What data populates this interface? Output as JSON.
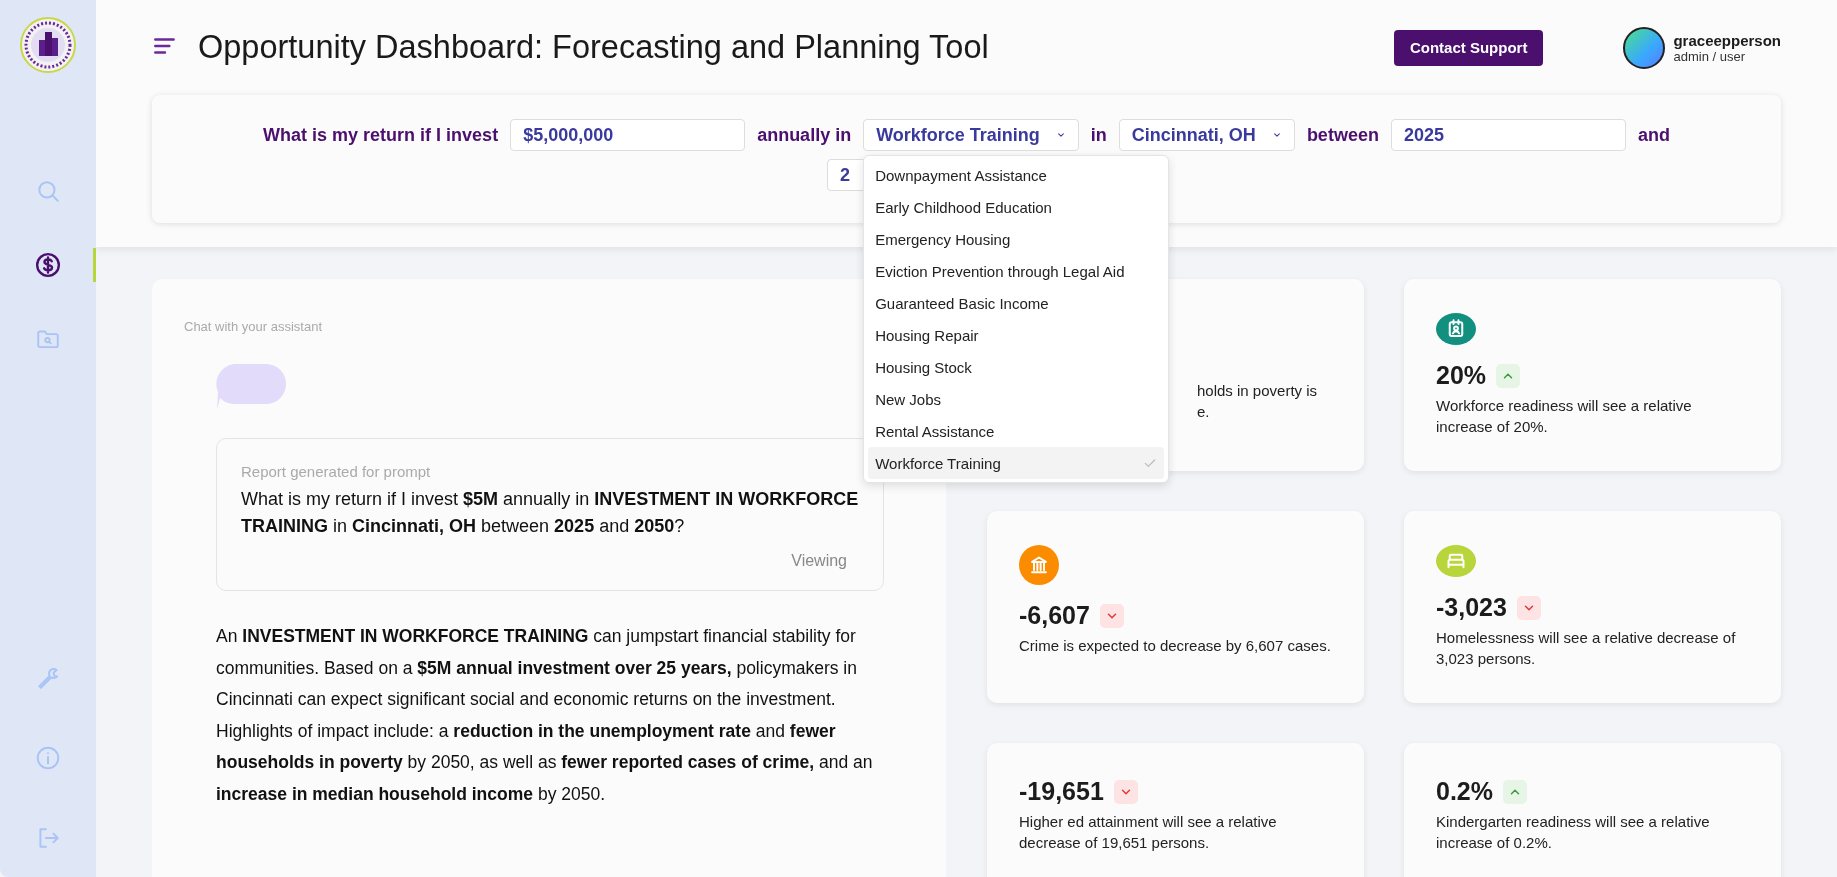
{
  "sidebar": {
    "items": [
      {
        "selected": false
      },
      {
        "selected": true
      },
      {
        "selected": false
      }
    ],
    "bottom_items": [
      {
        "selected": false
      },
      {
        "selected": false
      },
      {
        "selected": false
      }
    ]
  },
  "header": {
    "title": "Opportunity Dashboard: Forecasting and Planning Tool",
    "support_button": "Contact Support",
    "user": {
      "name": "graceepperson",
      "role": "admin / user"
    }
  },
  "query": [
    {
      "kind": "label",
      "text": "What is my return if I invest"
    },
    {
      "kind": "input",
      "value": "$5,000,000"
    },
    {
      "kind": "label",
      "text": "annually in"
    },
    {
      "kind": "select",
      "value": "Workforce Training",
      "open": true,
      "options": [
        {
          "label": "Downpayment Assistance",
          "selected": false
        },
        {
          "label": "Early Childhood Education",
          "selected": false
        },
        {
          "label": "Emergency Housing",
          "selected": false
        },
        {
          "label": "Eviction Prevention through Legal Aid",
          "selected": false
        },
        {
          "label": "Guaranteed Basic Income",
          "selected": false
        },
        {
          "label": "Housing Repair",
          "selected": false
        },
        {
          "label": "Housing Stock",
          "selected": false
        },
        {
          "label": "New Jobs",
          "selected": false
        },
        {
          "label": "Rental Assistance",
          "selected": false
        },
        {
          "label": "Workforce Training",
          "selected": true
        }
      ]
    },
    {
      "kind": "label",
      "text": "in"
    },
    {
      "kind": "select",
      "value": "Cincinnati, OH",
      "open": false
    },
    {
      "kind": "label",
      "text": "between"
    },
    {
      "kind": "input",
      "value": "2025"
    },
    {
      "kind": "label",
      "text": "and"
    },
    {
      "kind": "input",
      "value": "2"
    }
  ],
  "chat": {
    "label": "Chat with your assistant",
    "report_label": "Report generated for prompt",
    "prompt": "What is my return if I invest **$5M** annually in **INVESTMENT IN WORKFORCE TRAINING** in **Cincinnati, OH** between **2025** and **2050**?",
    "status": "Viewing",
    "answer": "An **INVESTMENT IN WORKFORCE TRAINING** can jumpstart financial stability for communities. Based on a **$5M annual investment over 25 years,** policymakers in Cincinnati can expect significant social and economic returns on the investment. Highlights of impact include: a **reduction in the unemployment rate** and **fewer households in poverty** by 2050, as well as **fewer reported cases of crime,** and an **increase in median household income** by 2050."
  },
  "metrics": [
    {
      "kind": "covered",
      "lines": [
        "holds in poverty is",
        "e."
      ]
    },
    {
      "kind": "full",
      "color": "#11907f",
      "value": "20%",
      "increase": true,
      "description": "Workforce readiness will see a relative increase of 20%."
    },
    {
      "kind": "full",
      "color": "#fb8c00",
      "value": "-6,607",
      "increase": false,
      "description": "Crime is expected to decrease by 6,607 cases."
    },
    {
      "kind": "full",
      "color": "#b8d53b",
      "value": "-3,023",
      "increase": false,
      "description": "Homelessness will see a relative decrease of 3,023 persons."
    },
    {
      "kind": "full",
      "value": "-19,651",
      "increase": false,
      "description": "Higher ed attainment will see a relative decrease of 19,651 persons."
    },
    {
      "kind": "full",
      "value": "0.2%",
      "increase": true,
      "description": "Kindergarten readiness will see a relative increase of 0.2%."
    }
  ]
}
